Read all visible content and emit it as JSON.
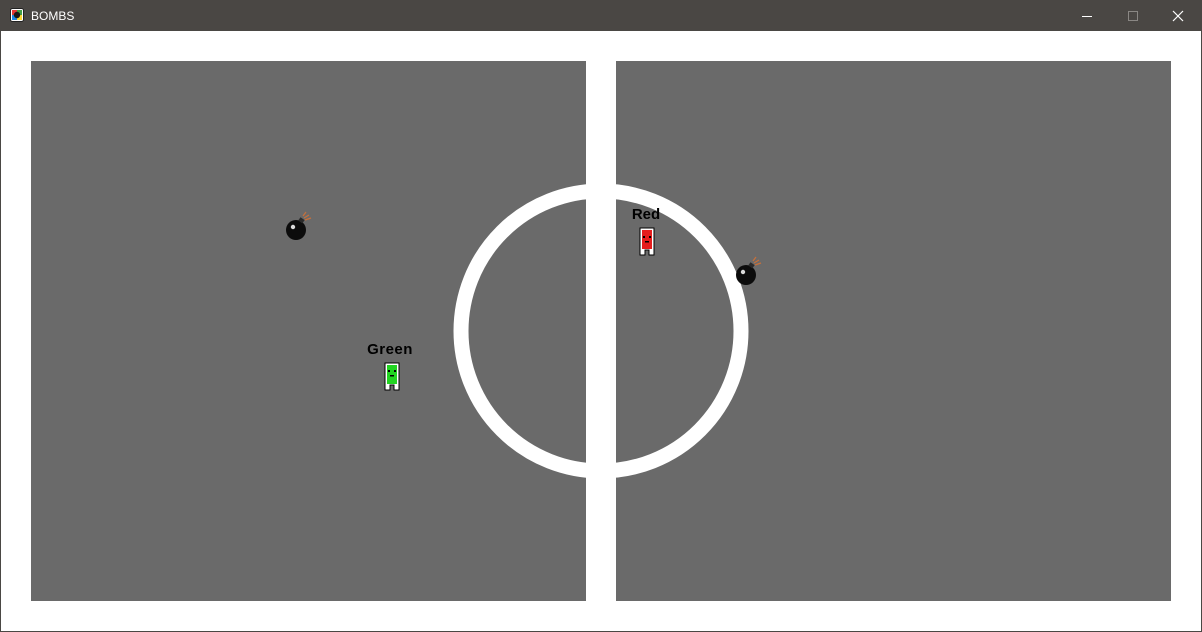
{
  "window": {
    "title": "BOMBS",
    "icon": "app-icon",
    "controls": [
      "minimize-icon",
      "maximize-icon",
      "close-icon"
    ]
  },
  "colors": {
    "titlebar": "#4a4744",
    "field": "#6a6a6a",
    "lines": "#ffffff",
    "red_player": "#e51d1d",
    "green_player": "#22d422",
    "bomb": "#0c0c0c",
    "fuse": "#c8703a"
  },
  "players": [
    {
      "name": "Red",
      "team_color": "#e51d1d"
    },
    {
      "name": "Green",
      "team_color": "#22d422"
    }
  ],
  "bombs": [
    {
      "side": "left",
      "icon": "bomb-icon"
    },
    {
      "side": "right",
      "icon": "bomb-icon"
    }
  ]
}
